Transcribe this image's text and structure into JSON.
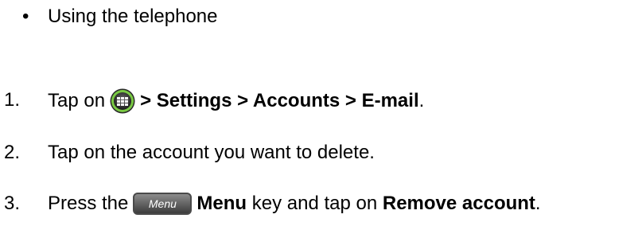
{
  "bullet": {
    "symbol": "•",
    "text": "Using the telephone"
  },
  "steps": [
    {
      "number": "1.",
      "prefix": "Tap on",
      "icon": "apps-grid-icon",
      "path": "> Settings > Accounts > E-mail",
      "suffix": "."
    },
    {
      "number": "2.",
      "text": "Tap on the account you want to delete."
    },
    {
      "number": "3.",
      "prefix": "Press the",
      "icon_label": "Menu",
      "key_name": "Menu",
      "middle": "key and tap on",
      "action": "Remove account",
      "suffix": "."
    }
  ]
}
